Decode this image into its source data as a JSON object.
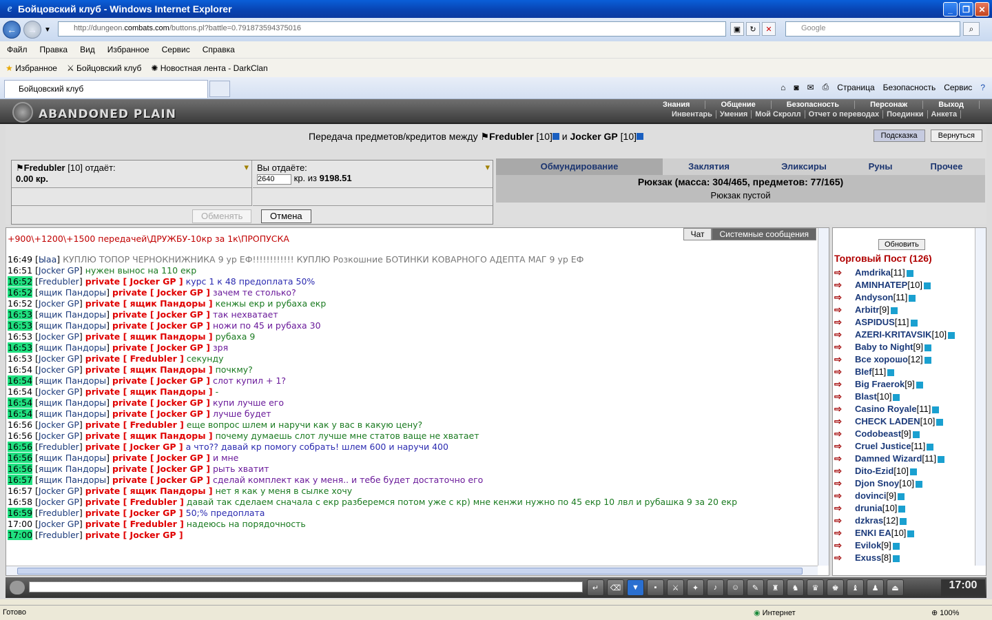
{
  "window": {
    "title": "Бойцовский клуб - Windows Internet Explorer"
  },
  "address": {
    "prefix": "http://dungeon.",
    "host": "combats.com",
    "rest": "/buttons.pl?battle=0.791873594375016"
  },
  "search": {
    "placeholder": "Google"
  },
  "menu": [
    "Файл",
    "Правка",
    "Вид",
    "Избранное",
    "Сервис",
    "Справка"
  ],
  "favorites": {
    "label": "Избранное",
    "items": [
      "Бойцовский клуб",
      "Новостная лента - DarkClan"
    ]
  },
  "tab": {
    "label": "Бойцовский клуб"
  },
  "cmd": [
    "Страница",
    "Безопасность",
    "Сервис"
  ],
  "game": {
    "location": "ABANDONED PLAIN",
    "nav": [
      "Знания",
      "Общение",
      "Безопасность",
      "Персонаж",
      "Выход"
    ],
    "subnav": [
      "Инвентарь",
      "Умения",
      "Мой Скролл",
      "Отчет о переводах",
      "Поединки",
      "Анкета"
    ],
    "transfer": {
      "title_prefix": "Передача предметов/кредитов между",
      "p1": "Fredubler",
      "p1lvl": "[10]",
      "and": "и",
      "p2": "Jocker GP",
      "p2lvl": "[10]",
      "hint": "Подсказка",
      "back": "Вернуться",
      "gives_name": "Fredubler",
      "gives_lvl": "[10]",
      "gives_label": "отдаёт:",
      "gives_amount": "0.00 кр.",
      "you_give": "Вы отдаёте:",
      "input": "2640",
      "kr_from": "кр. из",
      "total": "9198.51",
      "exchange": "Обменять",
      "cancel": "Отмена",
      "tabs": [
        "Обмундирование",
        "Заклятия",
        "Эликсиры",
        "Руны",
        "Прочее"
      ],
      "backpack": "Рюкзак (масса: 304/465, предметов: 77/165)",
      "empty": "Рюкзак пустой"
    },
    "chat": {
      "tabs": [
        "Чат",
        "Системные сообщения"
      ],
      "topline": "+900\\+1200\\+1500 передачей\\ДРУЖБУ-10кр за 1к\\ПРОПУСКА",
      "messages": [
        {
          "t": "16:49",
          "hl": false,
          "n": "Ыаа",
          "p": "",
          "x": "КУПЛЮ ТОПОР ЧЕРНОКНИЖНИКА 9 ур ЕФ!!!!!!!!!!!! КУПЛЮ Розкошние БОТИНКИ КОВАРНОГО АДЕПТА МАГ 9 ур ЕФ",
          "c": "gray"
        },
        {
          "t": "16:51",
          "hl": false,
          "n": "Jocker GP",
          "p": "",
          "x": "нужен вынос на 110 екр",
          "c": "g"
        },
        {
          "t": "16:52",
          "hl": true,
          "n": "Fredubler",
          "p": "private [ Jocker GP ]",
          "x": "курс 1 к 48 предоплата 50%",
          "c": "b"
        },
        {
          "t": "16:52",
          "hl": true,
          "n": "ящик Пандоры",
          "p": "private [ Jocker GP ]",
          "x": "зачем те столько?",
          "c": "p"
        },
        {
          "t": "16:52",
          "hl": false,
          "n": "Jocker GP",
          "p": "private [ ящик Пандоры ]",
          "x": "кенжы екр и рубаха екр",
          "c": "g"
        },
        {
          "t": "16:53",
          "hl": true,
          "n": "ящик Пандоры",
          "p": "private [ Jocker GP ]",
          "x": "так нехватает",
          "c": "p"
        },
        {
          "t": "16:53",
          "hl": true,
          "n": "ящик Пандоры",
          "p": "private [ Jocker GP ]",
          "x": "ножи по 45 и рубаха 30",
          "c": "p"
        },
        {
          "t": "16:53",
          "hl": false,
          "n": "Jocker GP",
          "p": "private [ ящик Пандоры ]",
          "x": "рубаха 9",
          "c": "g"
        },
        {
          "t": "16:53",
          "hl": true,
          "n": "ящик Пандоры",
          "p": "private [ Jocker GP ]",
          "x": "зря",
          "c": "p"
        },
        {
          "t": "16:53",
          "hl": false,
          "n": "Jocker GP",
          "p": "private [ Fredubler ]",
          "x": "секунду",
          "c": "g"
        },
        {
          "t": "16:54",
          "hl": false,
          "n": "Jocker GP",
          "p": "private [ ящик Пандоры ]",
          "x": "почкму?",
          "c": "g"
        },
        {
          "t": "16:54",
          "hl": true,
          "n": "ящик Пандоры",
          "p": "private [ Jocker GP ]",
          "x": "слот купил + 1?",
          "c": "p"
        },
        {
          "t": "16:54",
          "hl": false,
          "n": "Jocker GP",
          "p": "private [ ящик Пандоры ]",
          "x": "-",
          "c": "g"
        },
        {
          "t": "16:54",
          "hl": true,
          "n": "ящик Пандоры",
          "p": "private [ Jocker GP ]",
          "x": "купи лучше его",
          "c": "p"
        },
        {
          "t": "16:54",
          "hl": true,
          "n": "ящик Пандоры",
          "p": "private [ Jocker GP ]",
          "x": "лучше будет",
          "c": "p"
        },
        {
          "t": "16:56",
          "hl": false,
          "n": "Jocker GP",
          "p": "private [ Fredubler ]",
          "x": "еще вопрос шлем и наручи как у вас в какую цену?",
          "c": "g"
        },
        {
          "t": "16:56",
          "hl": false,
          "n": "Jocker GP",
          "p": "private [ ящик Пандоры ]",
          "x": "почему думаешь слот лучше мне статов ваще не хватает",
          "c": "g"
        },
        {
          "t": "16:56",
          "hl": true,
          "n": "Fredubler",
          "p": "private [ Jocker GP ]",
          "x": "а что?? давай кр помогу собрать! шлем 600 и наручи 400",
          "c": "b"
        },
        {
          "t": "16:56",
          "hl": true,
          "n": "ящик Пандоры",
          "p": "private [ Jocker GP ]",
          "x": "и мне",
          "c": "p"
        },
        {
          "t": "16:56",
          "hl": true,
          "n": "ящик Пандоры",
          "p": "private [ Jocker GP ]",
          "x": "рыть хватит",
          "c": "p"
        },
        {
          "t": "16:57",
          "hl": true,
          "n": "ящик Пандоры",
          "p": "private [ Jocker GP ]",
          "x": "сделай комплект как у меня.. и тебе будет достаточно его",
          "c": "p"
        },
        {
          "t": "16:57",
          "hl": false,
          "n": "Jocker GP",
          "p": "private [ ящик Пандоры ]",
          "x": "нет я как у меня в сылке хочу",
          "c": "g"
        },
        {
          "t": "16:58",
          "hl": false,
          "n": "Jocker GP",
          "p": "private [ Fredubler ]",
          "x": "давай так сделаем сначала с екр разберемся потом уже с кр) мне кенжи нужно по 45 екр 10 лвл и рубашка 9 за 20 екр",
          "c": "g"
        },
        {
          "t": "16:59",
          "hl": true,
          "n": "Fredubler",
          "p": "private [ Jocker GP ]",
          "x": "50;% предоплата",
          "c": "b"
        },
        {
          "t": "17:00",
          "hl": false,
          "n": "Jocker GP",
          "p": "private [ Fredubler ]",
          "x": "надеюсь на порядочность",
          "c": "g"
        },
        {
          "t": "17:00",
          "hl": true,
          "n": "Fredubler",
          "p": "private [ Jocker GP ]",
          "x": "",
          "c": "b"
        }
      ]
    },
    "sidebar": {
      "refresh": "Обновить",
      "title": "Торговый Пост (126)",
      "players": [
        {
          "n": "Amdrika",
          "l": "[11]"
        },
        {
          "n": "AMINHATEP",
          "l": "[10]"
        },
        {
          "n": "Andyson",
          "l": "[11]"
        },
        {
          "n": "Arbitr",
          "l": "[9]"
        },
        {
          "n": "ASPIDUS",
          "l": "[11]"
        },
        {
          "n": "AZERI-KRITAVSIK",
          "l": "[10]"
        },
        {
          "n": "Baby to Night",
          "l": "[9]"
        },
        {
          "n": "Все хорошо",
          "l": "[12]"
        },
        {
          "n": "BIef",
          "l": "[11]"
        },
        {
          "n": "Big Fraerok",
          "l": "[9]"
        },
        {
          "n": "Blast",
          "l": "[10]"
        },
        {
          "n": "Casino Royale",
          "l": "[11]"
        },
        {
          "n": "CHECK LADEN",
          "l": "[10]"
        },
        {
          "n": "Codobeast",
          "l": "[9]"
        },
        {
          "n": "Cruel Justice",
          "l": "[11]"
        },
        {
          "n": "Damned Wizard",
          "l": "[11]"
        },
        {
          "n": "Dito-Ezid",
          "l": "[10]"
        },
        {
          "n": "Djon Snoy",
          "l": "[10]"
        },
        {
          "n": "dovinci",
          "l": "[9]"
        },
        {
          "n": "drunia",
          "l": "[10]"
        },
        {
          "n": "dzkras",
          "l": "[12]"
        },
        {
          "n": "ENKI EA",
          "l": "[10]"
        },
        {
          "n": "Evilok",
          "l": "[9]"
        },
        {
          "n": "Exuss",
          "l": "[8]"
        }
      ]
    },
    "clock": "17:00"
  },
  "status": {
    "left": "Готово",
    "zone": "Интернет",
    "zoom": "100%"
  }
}
